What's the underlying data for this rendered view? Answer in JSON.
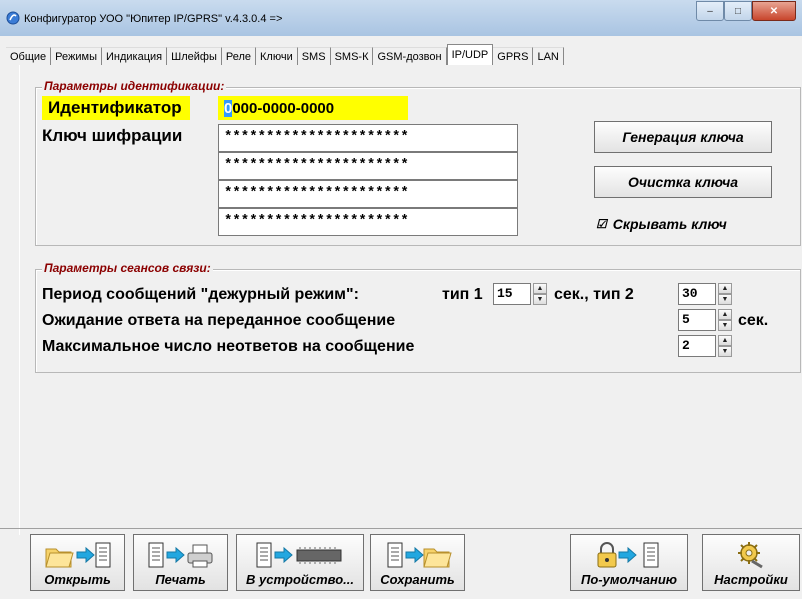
{
  "window": {
    "title": "Конфигуратор УОО \"Юпитер IP/GPRS\" v.4.3.0.4  =>",
    "minimize_glyph": "–",
    "maximize_glyph": "□",
    "close_glyph": "✕"
  },
  "tabs": [
    {
      "label": "Общие"
    },
    {
      "label": "Режимы"
    },
    {
      "label": "Индикация"
    },
    {
      "label": "Шлейфы"
    },
    {
      "label": "Реле"
    },
    {
      "label": "Ключи"
    },
    {
      "label": "SMS"
    },
    {
      "label": "SMS-К"
    },
    {
      "label": "GSM-дозвон"
    },
    {
      "label": "IP/UDP"
    },
    {
      "label": "GPRS"
    },
    {
      "label": "LAN"
    }
  ],
  "active_tab": "IP/UDP",
  "ident": {
    "group_title": "Параметры идентификации:",
    "id_label": "Идентификатор",
    "id_value_first": "0",
    "id_value_rest": "000-0000-0000",
    "key_label": "Ключ шифрации",
    "key_rows": [
      "**********************",
      "**********************",
      "**********************",
      "**********************"
    ],
    "generate_button": "Генерация ключа",
    "clear_button": "Очистка ключа",
    "hide_key_label": "Скрывать ключ",
    "hide_key_checked": true,
    "check_glyph": "☑"
  },
  "session": {
    "group_title": "Параметры сеансов связи:",
    "period_label": "Период сообщений \"дежурный режим\":",
    "type1_label": "тип 1",
    "type1_value": "15",
    "sec_type2_label": "сек., тип 2",
    "type2_value": "30",
    "wait_label": "Ожидание ответа на переданное сообщение",
    "wait_value": "5",
    "wait_unit": "сек.",
    "max_label": "Максимальное число неответов на сообщение",
    "max_value": "2",
    "arrow_up": "▲",
    "arrow_down": "▼"
  },
  "toolbar": {
    "open": "Открыть",
    "print": "Печать",
    "to_device": "В устройство...",
    "save": "Сохранить",
    "defaults": "По-умолчанию",
    "settings": "Настройки"
  },
  "colors": {
    "highlight": "#ffff00",
    "group_title": "#8b0000",
    "selection": "#3399ff"
  }
}
